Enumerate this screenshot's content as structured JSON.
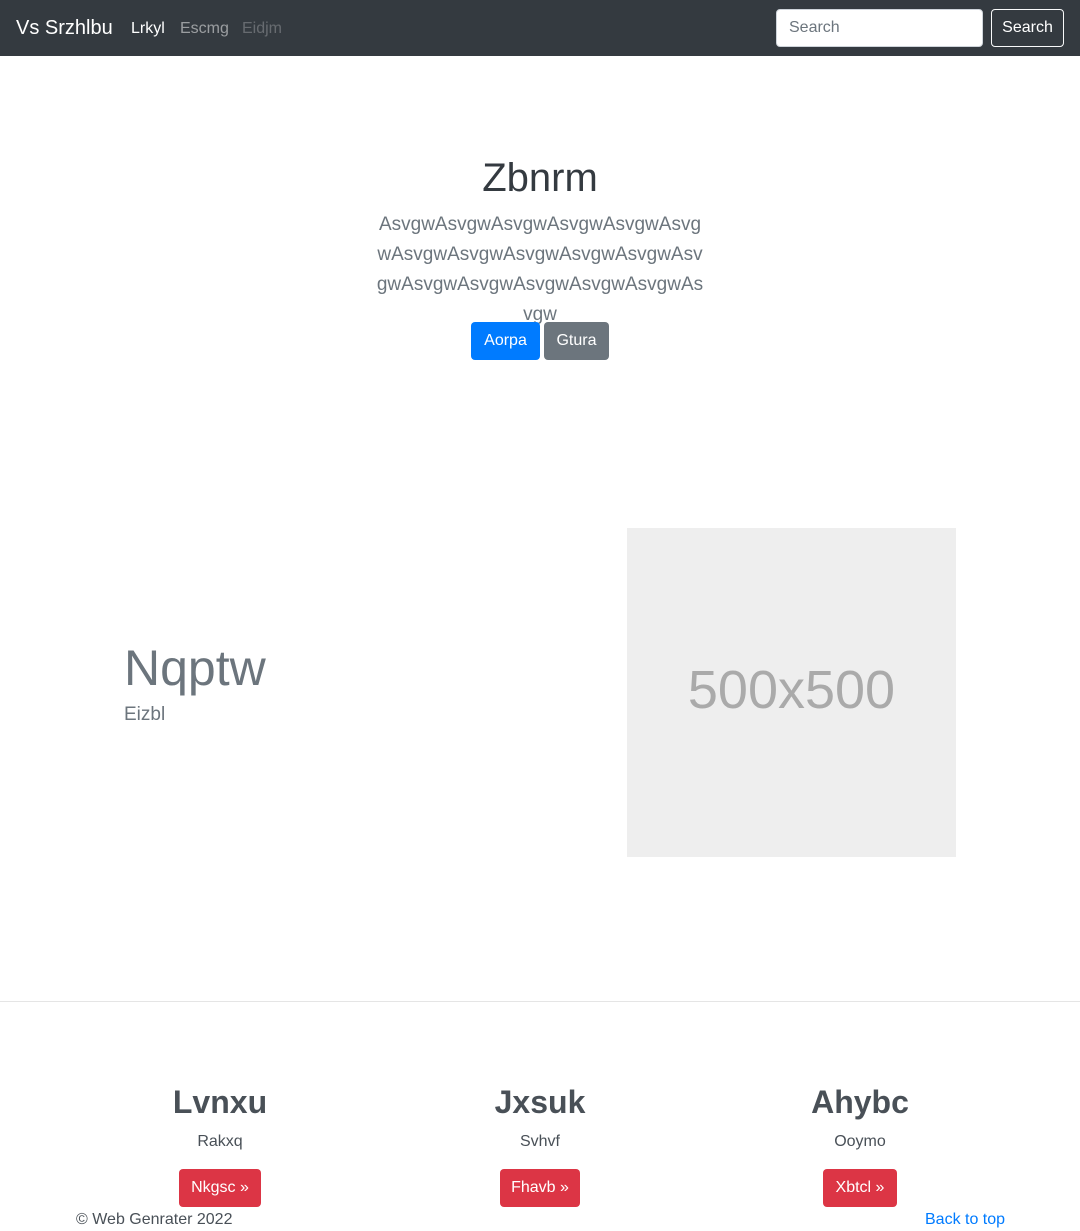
{
  "navbar": {
    "brand": "Vs Srzhlbu",
    "links": [
      "Lrkyl",
      "Escmg",
      "Eidjm"
    ],
    "search_placeholder": "Search",
    "search_button": "Search"
  },
  "hero": {
    "title": "Zbnrm",
    "lead": "AsvgwAsvgwAsvgwAsvgwAsvgwAsvgwAsvgwAsvgwAsvgwAsvgwAsvgwAsvgwAsvgwAsvgwAsvgwAsvgwAsvgwAsvgw",
    "primary_button": "Aorpa",
    "secondary_button": "Gtura"
  },
  "feature": {
    "heading": "Nqptw",
    "subheading": "Eizbl",
    "image_label": "500x500"
  },
  "columns": [
    {
      "title": "Lvnxu",
      "text": "Rakxq",
      "button": "Nkgsc »"
    },
    {
      "title": "Jxsuk",
      "text": "Svhvf",
      "button": "Fhavb »"
    },
    {
      "title": "Ahybc",
      "text": "Ooymo",
      "button": "Xbtcl »"
    }
  ],
  "footer": {
    "copyright": "© Web Genrater 2022",
    "back_to_top": "Back to top"
  },
  "colors": {
    "navbar_bg": "#343a40",
    "primary": "#007bff",
    "secondary": "#6c757d",
    "danger": "#dc3545"
  }
}
